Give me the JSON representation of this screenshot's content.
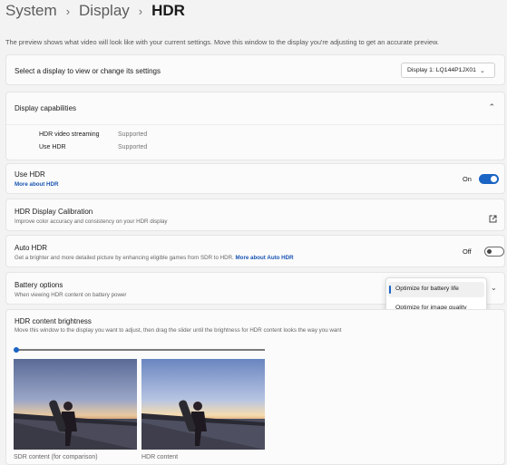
{
  "breadcrumb": {
    "items": [
      "System",
      "Display"
    ],
    "current": "HDR",
    "separator": "›"
  },
  "preview_note": "The preview shows what video will look like with your current settings. Move this window to the display you're adjusting to get an accurate preview.",
  "display_select": {
    "label": "Select a display to view or change its settings",
    "value": "Display 1: LQ144P1JX01"
  },
  "capabilities": {
    "title": "Display capabilities",
    "rows": [
      {
        "key": "HDR video streaming",
        "value": "Supported"
      },
      {
        "key": "Use HDR",
        "value": "Supported"
      }
    ]
  },
  "use_hdr": {
    "title": "Use HDR",
    "link": "More about HDR",
    "state": "On"
  },
  "calibration": {
    "title": "HDR Display Calibration",
    "subtitle": "Improve color accuracy and consistency on your HDR display"
  },
  "auto_hdr": {
    "title": "Auto HDR",
    "subtitle": "Get a brighter and more detailed picture by enhancing eligible games from SDR to HDR.",
    "link": "More about Auto HDR",
    "state": "Off"
  },
  "battery": {
    "title": "Battery options",
    "subtitle": "When viewing HDR content on battery power",
    "options": [
      "Optimize for battery life",
      "Optimize for image quality"
    ],
    "selected_index": 0
  },
  "brightness": {
    "title": "HDR content brightness",
    "subtitle": "Move this window to the display you want to adjust, then drag the slider until the brightness for HDR content looks the way you want",
    "slider_value": 0
  },
  "previews": {
    "sdr_caption": "SDR content (for comparison)",
    "hdr_caption": "HDR content"
  },
  "colors": {
    "accent": "#1a64c4",
    "link": "#1a55b4",
    "background": "#f3f3f3",
    "card": "#fbfbfb"
  }
}
